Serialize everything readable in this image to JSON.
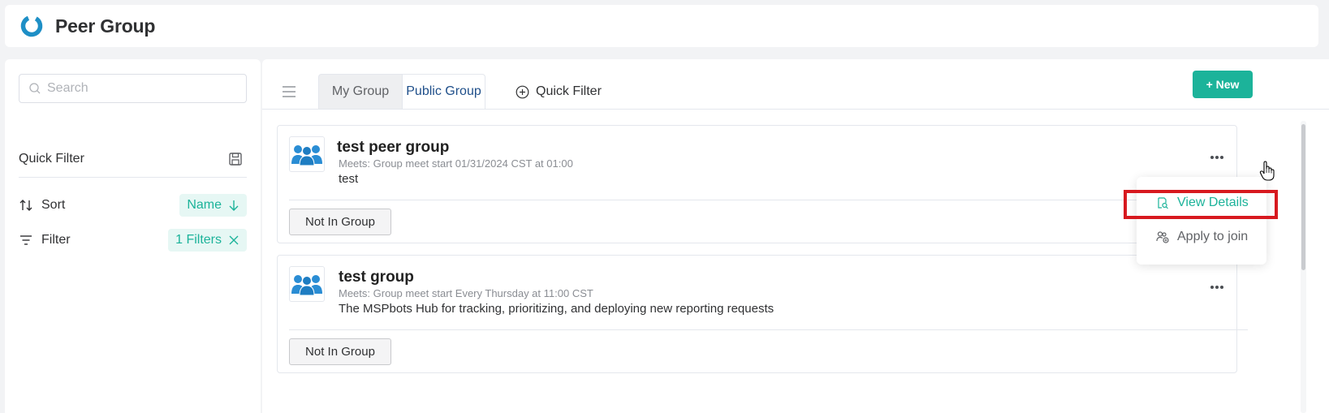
{
  "header": {
    "title": "Peer Group",
    "logo_icon": "refresh-ring-logo",
    "accent": "#1e8fc6"
  },
  "sidebar": {
    "search_placeholder": "Search",
    "quick_filter_label": "Quick Filter",
    "sort": {
      "label": "Sort",
      "value": "Name"
    },
    "filter": {
      "label": "Filter",
      "value": "1 Filters"
    }
  },
  "tabs": [
    {
      "label": "My Group",
      "active": false
    },
    {
      "label": "Public Group",
      "active": true
    }
  ],
  "quick_filter_tab": "Quick Filter",
  "new_button": "+ New",
  "groups": [
    {
      "name": "test peer group",
      "meets": "Meets: Group meet start 01/31/2024 CST at 01:00",
      "description": "test",
      "status": "Not In Group"
    },
    {
      "name": "test group",
      "meets": "Meets: Group meet start Every Thursday at 11:00 CST",
      "description": "The MSPbots Hub for tracking, prioritizing, and deploying new reporting requests",
      "status": "Not In Group"
    }
  ],
  "dropdown": {
    "items": [
      {
        "label": "View Details",
        "icon": "document-search-icon"
      },
      {
        "label": "Apply to join",
        "icon": "user-add-icon"
      }
    ]
  },
  "colors": {
    "accent": "#1cb39a",
    "highlight": "#d7191f",
    "tab_active_text": "#1f4f8a"
  }
}
